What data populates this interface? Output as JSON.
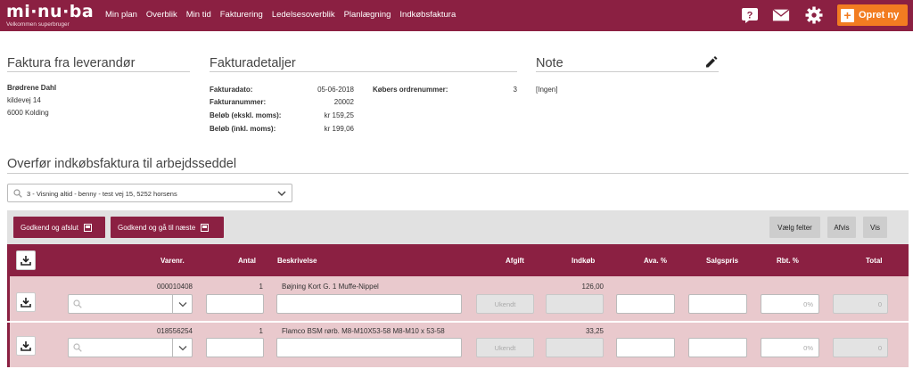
{
  "header": {
    "logo": "mi·nu·ba",
    "subtitle": "Velkommen  superbruger",
    "nav": [
      "Min plan",
      "Overblik",
      "Min tid",
      "Fakturering",
      "Ledelsesoverblik",
      "Planlægning",
      "Indkøbsfaktura"
    ],
    "create_label": "Opret ny",
    "accent": "#8b2042",
    "create_color": "#f27c21"
  },
  "supplier": {
    "title": "Faktura fra leverandør",
    "name": "Brødrene Dahl",
    "street": "kildevej 14",
    "city": "6000 Kolding"
  },
  "invoice": {
    "title": "Fakturadetaljer",
    "date_label": "Fakturadato:",
    "date_value": "05-06-2018",
    "number_label": "Fakturanummer:",
    "number_value": "20002",
    "ex_vat_label": "Beløb (ekskl. moms):",
    "ex_vat_value": "kr 159,25",
    "inc_vat_label": "Beløb (inkl. moms):",
    "inc_vat_value": "kr 199,06",
    "buyer_order_label": "Købers ordrenummer:",
    "buyer_order_value": "3"
  },
  "note": {
    "title": "Note",
    "value": "[Ingen]"
  },
  "transfer": {
    "title": "Overfør indkøbsfaktura til arbejdsseddel",
    "selected": "3 - Visning altid - benny - test vej 15, 5252 horsens"
  },
  "actions": {
    "approve_close": "Godkend og afslut",
    "approve_next": "Godkend og gå til næste",
    "choose_fields": "Vælg felter",
    "reject": "Afvis",
    "show": "Vis"
  },
  "table": {
    "headers": {
      "item_no": "Varenr.",
      "qty": "Antal",
      "description": "Beskrivelse",
      "fee": "Afgift",
      "purchase": "Indkøb",
      "markup": "Ava. %",
      "sales_price": "Salgspris",
      "discount": "Rbt. %",
      "total": "Total"
    },
    "rows": [
      {
        "item_no": "000010408",
        "qty": "1",
        "description": "Bøjning Kort G. 1 Muffe-Nippel",
        "fee": "Ukendt",
        "purchase": "126,00",
        "discount": "0%",
        "total": "0"
      },
      {
        "item_no": "018556254",
        "qty": "1",
        "description": "Flamco BSM rørb. M8-M10X53-58 M8-M10 x 53-58",
        "fee": "Ukendt",
        "purchase": "33,25",
        "discount": "0%",
        "total": "0"
      }
    ]
  }
}
